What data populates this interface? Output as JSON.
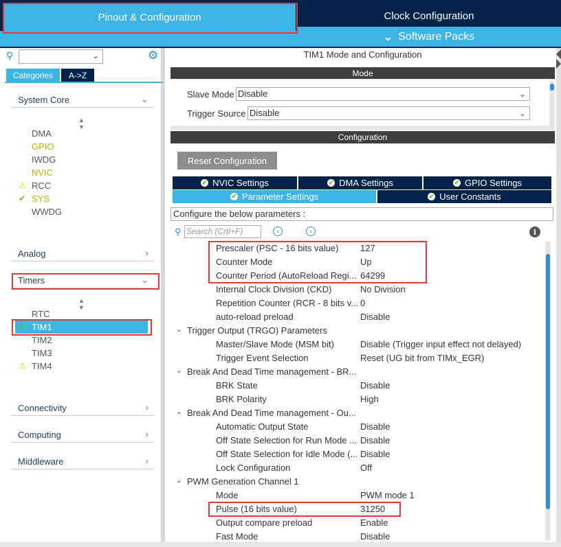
{
  "top_tabs": {
    "pinout": "Pinout & Configuration",
    "clock": "Clock Configuration",
    "software_packs": "Software Packs"
  },
  "left": {
    "search_value": "",
    "tabs": [
      "Categories",
      "A->Z"
    ],
    "sections": {
      "system_core": "System Core",
      "analog": "Analog",
      "timers": "Timers",
      "connectivity": "Connectivity",
      "computing": "Computing",
      "middleware": "Middleware"
    },
    "system_core_items": [
      {
        "label": "DMA",
        "status": "none"
      },
      {
        "label": "GPIO",
        "status": "configured"
      },
      {
        "label": "IWDG",
        "status": "none"
      },
      {
        "label": "NVIC",
        "status": "configured"
      },
      {
        "label": "RCC",
        "status": "warning"
      },
      {
        "label": "SYS",
        "status": "ok"
      },
      {
        "label": "WWDG",
        "status": "none"
      }
    ],
    "timer_items": [
      {
        "label": "RTC",
        "status": "none"
      },
      {
        "label": "TIM1",
        "status": "ok"
      },
      {
        "label": "TIM2",
        "status": "none"
      },
      {
        "label": "TIM3",
        "status": "none"
      },
      {
        "label": "TIM4",
        "status": "warning"
      }
    ]
  },
  "right": {
    "title": "TIM1 Mode and Configuration",
    "mode_header": "Mode",
    "slave_mode": {
      "label": "Slave Mode",
      "value": "Disable"
    },
    "trigger_source": {
      "label": "Trigger Source",
      "value": "Disable"
    },
    "config_header": "Configuration",
    "reset_button": "Reset Configuration",
    "settings_tabs": {
      "nvic": "NVIC Settings",
      "dma": "DMA Settings",
      "gpio": "GPIO Settings",
      "parameter": "Parameter Settings",
      "user_constants": "User Constants"
    },
    "param_hint": "Configure the below parameters :",
    "search_placeholder": "Search (Crtl+F)",
    "rows": [
      {
        "type": "param",
        "name": "Prescaler (PSC - 16 bits value)",
        "value": "127"
      },
      {
        "type": "param",
        "name": "Counter Mode",
        "value": "Up"
      },
      {
        "type": "param",
        "name": "Counter Period (AutoReload Regi...",
        "value": "64299"
      },
      {
        "type": "param",
        "name": "Internal Clock Division (CKD)",
        "value": "No Division"
      },
      {
        "type": "param",
        "name": "Repetition Counter (RCR - 8 bits v...",
        "value": "0"
      },
      {
        "type": "param",
        "name": "auto-reload preload",
        "value": "Disable"
      },
      {
        "type": "group",
        "name": "Trigger Output (TRGO) Parameters"
      },
      {
        "type": "param",
        "name": "Master/Slave Mode (MSM bit)",
        "value": "Disable (Trigger input effect not delayed)"
      },
      {
        "type": "param",
        "name": "Trigger Event Selection",
        "value": "Reset (UG bit from TIMx_EGR)"
      },
      {
        "type": "group",
        "name": "Break And Dead Time management - BR..."
      },
      {
        "type": "param",
        "name": "BRK State",
        "value": "Disable"
      },
      {
        "type": "param",
        "name": "BRK Polarity",
        "value": "High"
      },
      {
        "type": "group",
        "name": "Break And Dead Time management - Ou..."
      },
      {
        "type": "param",
        "name": "Automatic Output State",
        "value": "Disable"
      },
      {
        "type": "param",
        "name": "Off State Selection for Run Mode ...",
        "value": "Disable"
      },
      {
        "type": "param",
        "name": "Off State Selection for Idle Mode (...",
        "value": "Disable"
      },
      {
        "type": "param",
        "name": "Lock Configuration",
        "value": "Off"
      },
      {
        "type": "group",
        "name": "PWM Generation Channel 1"
      },
      {
        "type": "param",
        "name": "Mode",
        "value": "PWM mode 1"
      },
      {
        "type": "param",
        "name": "Pulse (16 bits value)",
        "value": "31250"
      },
      {
        "type": "param",
        "name": "Output compare preload",
        "value": "Enable"
      },
      {
        "type": "param",
        "name": "Fast Mode",
        "value": "Disable"
      }
    ]
  },
  "colors": {
    "accent_blue": "#3cb4e5",
    "navy": "#03234b",
    "highlight_red": "#e53935",
    "ok_green": "#7ab800",
    "warning_yellow": "#f2c200",
    "configured_gold": "#b5b300"
  }
}
